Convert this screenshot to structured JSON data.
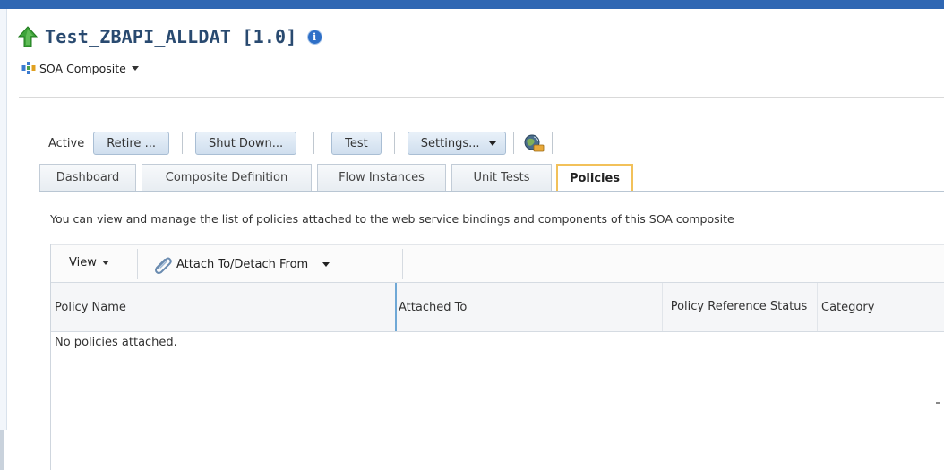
{
  "header": {
    "title": "Test_ZBAPI_ALLDAT [1.0]",
    "subtitle": "SOA Composite"
  },
  "toolbar": {
    "state": "Active",
    "retire": "Retire ...",
    "shutdown": "Shut Down...",
    "test": "Test",
    "settings": "Settings..."
  },
  "tabs": [
    {
      "label": "Dashboard"
    },
    {
      "label": "Composite Definition"
    },
    {
      "label": "Flow Instances"
    },
    {
      "label": "Unit Tests"
    },
    {
      "label": "Policies"
    }
  ],
  "policies": {
    "description": "You can view and manage the list of policies attached to the web service bindings and components of this SOA composite",
    "view_menu": "View",
    "attach_button": "Attach To/Detach From",
    "columns": [
      "Policy Name",
      "Attached To",
      "Policy Reference Status",
      "Category"
    ],
    "empty_message": "No policies attached."
  },
  "colors": {
    "accent": "#2f67b3",
    "title": "#294a70",
    "active_tab_border": "#f2c15a"
  }
}
